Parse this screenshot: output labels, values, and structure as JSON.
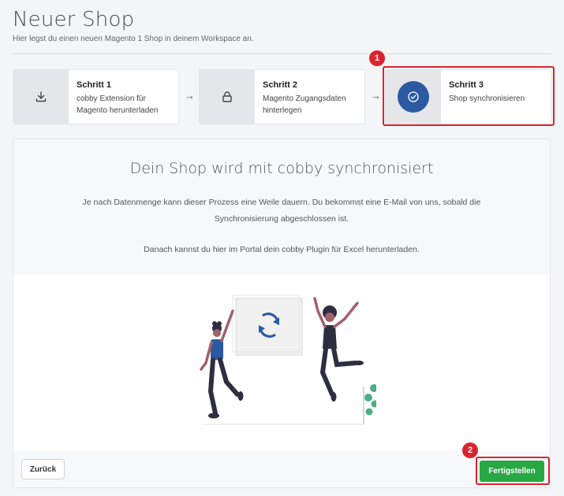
{
  "header": {
    "title": "Neuer Shop",
    "subtitle": "Hier legst du einen neuen Magento 1 Shop in deinem Workspace an."
  },
  "steps": [
    {
      "title": "Schritt 1",
      "description_line1": "cobby Extension für",
      "description_line2": "Magento herunterladen",
      "icon": "download-icon"
    },
    {
      "title": "Schritt 2",
      "description_line1": "Magento Zugangsdaten",
      "description_line2": "hinterlegen",
      "icon": "lock-icon"
    },
    {
      "title": "Schritt 3",
      "description_line1": "Shop synchronisieren",
      "description_line2": "",
      "icon": "check-circle-icon"
    }
  ],
  "step_arrow": "→",
  "annotations": {
    "badge1": "1",
    "badge2": "2"
  },
  "panel": {
    "heading": "Dein Shop wird mit cobby synchronisiert",
    "text_line1": "Je nach Datenmenge kann dieser Prozess eine Weile dauern. Du bekommst eine E-Mail von uns, sobald die",
    "text_line2": "Synchronisierung abgeschlossen ist.",
    "text_line3": "Danach kannst du hier im Portal dein cobby Plugin für Excel herunterladen."
  },
  "buttons": {
    "back": "Zurück",
    "finish": "Fertigstellen"
  },
  "colors": {
    "accent_blue": "#2c5aa0",
    "finish_green": "#28a745",
    "annotation_red": "#d9252e"
  }
}
